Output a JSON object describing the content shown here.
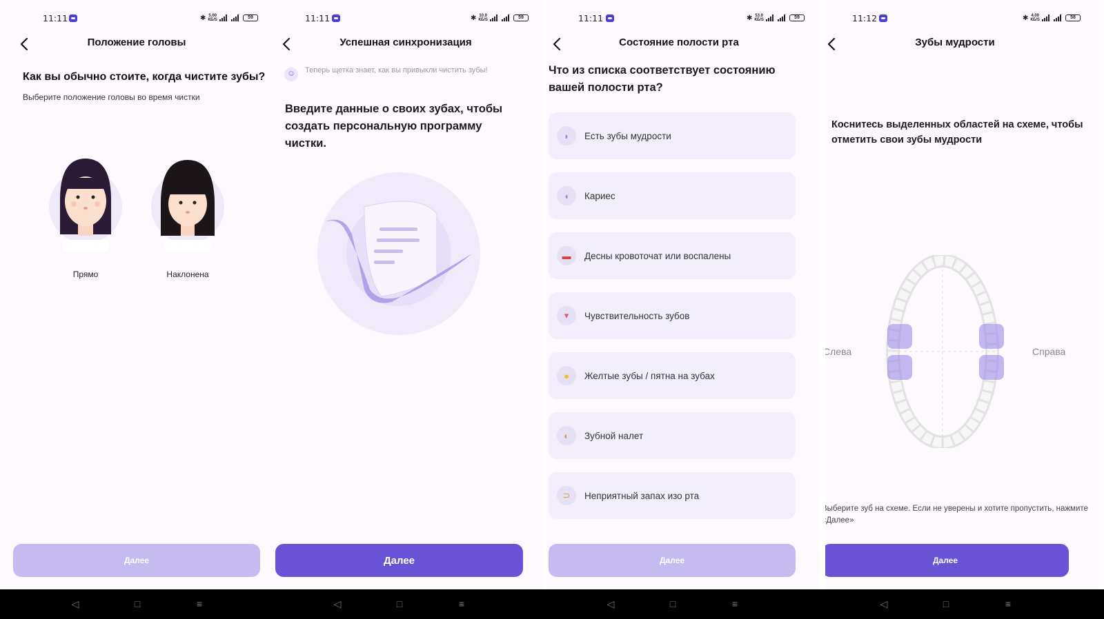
{
  "screens": [
    {
      "status": {
        "time": "11:11",
        "speed": "5.00\nКБ/S",
        "battery": "59"
      },
      "title": "Положение головы",
      "question": "Как вы обычно стоите, когда чистите зубы?",
      "subtitle": "Выберите положение головы во время чистки",
      "options": [
        "Прямо",
        "Наклонена"
      ],
      "button": "Далее"
    },
    {
      "status": {
        "time": "11:11",
        "speed": "10.0\nКБ/S",
        "battery": "59"
      },
      "title": "Успешная синхронизация",
      "hint": "Теперь щетка знает, как вы привыкли чистить зубы!",
      "heading": "Введите данные о своих зубах, чтобы создать персональную программу чистки.",
      "button": "Далее"
    },
    {
      "status": {
        "time": "11:11",
        "speed": "53.0\nКБ/S",
        "battery": "59"
      },
      "title": "Состояние полости рта",
      "question": "Что из списка соответствует состоянию вашей полости рта?",
      "options": [
        {
          "label": "Есть зубы мудрости",
          "icon": "wisdom-tooth-icon"
        },
        {
          "label": "Кариес",
          "icon": "caries-icon"
        },
        {
          "label": "Десны кровоточат или воспалены",
          "icon": "gum-icon"
        },
        {
          "label": "Чувствительность зубов",
          "icon": "sensitivity-icon"
        },
        {
          "label": "Желтые зубы / пятна на зубах",
          "icon": "stain-icon"
        },
        {
          "label": "Зубной налет",
          "icon": "plaque-icon"
        },
        {
          "label": "Неприятный запах изо рта",
          "icon": "breath-icon"
        }
      ],
      "button": "Далее"
    },
    {
      "status": {
        "time": "11:12",
        "speed": "4.00\nКБ/S",
        "battery": "58"
      },
      "title": "Зубы мудрости",
      "instruction": "Коснитесь выделенных областей на схеме, чтобы отметить свои зубы мудрости",
      "left_label": "Слева",
      "right_label": "Справа",
      "footnote": "Выберите зуб на схеме. Если не уверены и хотите пропустить, нажмите «Далее»",
      "button": "Далее"
    }
  ],
  "colors": {
    "accent": "#6a52d6",
    "disabled": "#c6bbf0",
    "option_bg": "#f2eefb"
  }
}
